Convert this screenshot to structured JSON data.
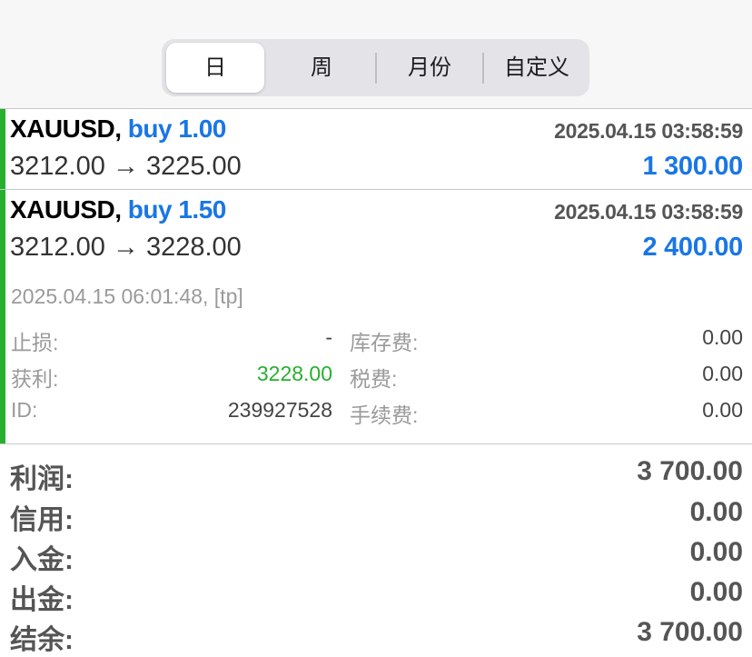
{
  "tabs": [
    "日",
    "周",
    "月份",
    "自定义"
  ],
  "active_tab": "日",
  "deals": [
    {
      "symbol": "XAUUSD,",
      "direction": "buy 1.00",
      "time": "2025.04.15 03:58:59",
      "prices": "3212.00 → 3225.00",
      "profit": "1 300.00"
    },
    {
      "symbol": "XAUUSD,",
      "direction": "buy 1.50",
      "time": "2025.04.15 03:58:59",
      "prices": "3212.00 → 3228.00",
      "profit": "2 400.00",
      "close_info": "2025.04.15 06:01:48, [tp]",
      "details": {
        "sl_label": "止损:",
        "sl_value": "-",
        "tp_label": "获利:",
        "tp_value": "3228.00",
        "id_label": "ID:",
        "id_value": "239927528",
        "swap_label": "库存费:",
        "swap_value": "0.00",
        "taxes_label": "税费:",
        "taxes_value": "0.00",
        "commission_label": "手续费:",
        "commission_value": "0.00"
      }
    }
  ],
  "summary": {
    "profit_label": "利润:",
    "profit_value": "3 700.00",
    "credit_label": "信用:",
    "credit_value": "0.00",
    "deposit_label": "入金:",
    "deposit_value": "0.00",
    "withdrawal_label": "出金:",
    "withdrawal_value": "0.00",
    "balance_label": "结余:",
    "balance_value": "3 700.00"
  },
  "colors": {
    "buy_blue": "#1976e6",
    "profit_green": "#27b02e",
    "label_gray": "#9a9a9a"
  }
}
